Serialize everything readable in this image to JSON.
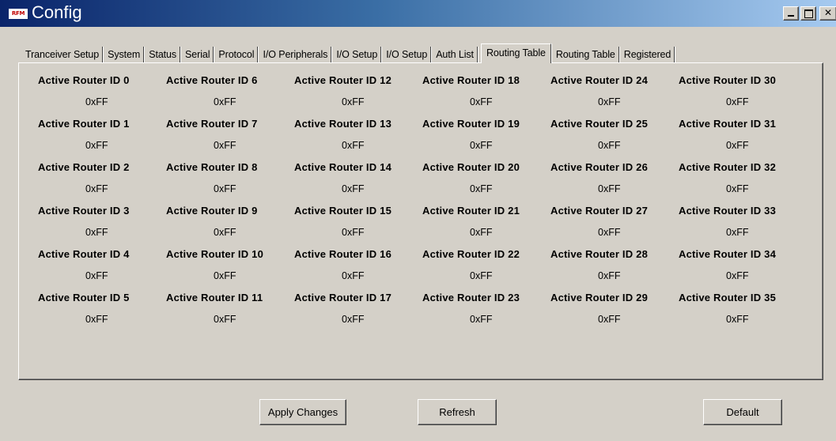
{
  "window": {
    "icon_text": "RFM",
    "title": "Config"
  },
  "tabs": [
    {
      "label": "Tranceiver Setup",
      "active": false
    },
    {
      "label": "System",
      "active": false
    },
    {
      "label": "Status",
      "active": false
    },
    {
      "label": "Serial",
      "active": false
    },
    {
      "label": "Protocol",
      "active": false
    },
    {
      "label": "I/O Peripherals",
      "active": false
    },
    {
      "label": "I/O Setup",
      "active": false
    },
    {
      "label": "I/O Setup",
      "active": false
    },
    {
      "label": "Auth List",
      "active": false
    },
    {
      "label": "Routing Table",
      "active": true
    },
    {
      "label": "Routing Table",
      "active": false
    },
    {
      "label": "Registered",
      "active": false
    }
  ],
  "routers": [
    [
      {
        "label": "Active Router ID 0",
        "value": "0xFF"
      },
      {
        "label": "Active Router ID 6",
        "value": "0xFF"
      },
      {
        "label": "Active Router ID 12",
        "value": "0xFF"
      },
      {
        "label": "Active Router ID 18",
        "value": "0xFF"
      },
      {
        "label": "Active Router ID 24",
        "value": "0xFF"
      },
      {
        "label": "Active Router ID 30",
        "value": "0xFF"
      }
    ],
    [
      {
        "label": "Active Router ID 1",
        "value": "0xFF"
      },
      {
        "label": "Active Router ID 7",
        "value": "0xFF"
      },
      {
        "label": "Active Router ID 13",
        "value": "0xFF"
      },
      {
        "label": "Active Router ID 19",
        "value": "0xFF"
      },
      {
        "label": "Active Router ID 25",
        "value": "0xFF"
      },
      {
        "label": "Active Router ID 31",
        "value": "0xFF"
      }
    ],
    [
      {
        "label": "Active Router ID 2",
        "value": "0xFF"
      },
      {
        "label": "Active Router ID 8",
        "value": "0xFF"
      },
      {
        "label": "Active Router ID 14",
        "value": "0xFF"
      },
      {
        "label": "Active Router ID 20",
        "value": "0xFF"
      },
      {
        "label": "Active Router ID 26",
        "value": "0xFF"
      },
      {
        "label": "Active Router ID 32",
        "value": "0xFF"
      }
    ],
    [
      {
        "label": "Active Router ID 3",
        "value": "0xFF"
      },
      {
        "label": "Active Router ID 9",
        "value": "0xFF"
      },
      {
        "label": "Active Router ID 15",
        "value": "0xFF"
      },
      {
        "label": "Active Router ID 21",
        "value": "0xFF"
      },
      {
        "label": "Active Router ID 27",
        "value": "0xFF"
      },
      {
        "label": "Active Router ID 33",
        "value": "0xFF"
      }
    ],
    [
      {
        "label": "Active Router ID 4",
        "value": "0xFF"
      },
      {
        "label": "Active Router ID 10",
        "value": "0xFF"
      },
      {
        "label": "Active Router ID 16",
        "value": "0xFF"
      },
      {
        "label": "Active Router ID 22",
        "value": "0xFF"
      },
      {
        "label": "Active Router ID 28",
        "value": "0xFF"
      },
      {
        "label": "Active Router ID 34",
        "value": "0xFF"
      }
    ],
    [
      {
        "label": "Active Router ID 5",
        "value": "0xFF"
      },
      {
        "label": "Active Router ID 11",
        "value": "0xFF"
      },
      {
        "label": "Active Router ID 17",
        "value": "0xFF"
      },
      {
        "label": "Active Router ID 23",
        "value": "0xFF"
      },
      {
        "label": "Active Router ID 29",
        "value": "0xFF"
      },
      {
        "label": "Active Router ID 35",
        "value": "0xFF"
      }
    ]
  ],
  "buttons": {
    "apply": "Apply Changes",
    "refresh": "Refresh",
    "default": "Default"
  },
  "colors": {
    "window_bg": "#d4d0c8",
    "titlebar_start": "#0a246a",
    "titlebar_end": "#a6caf0"
  }
}
